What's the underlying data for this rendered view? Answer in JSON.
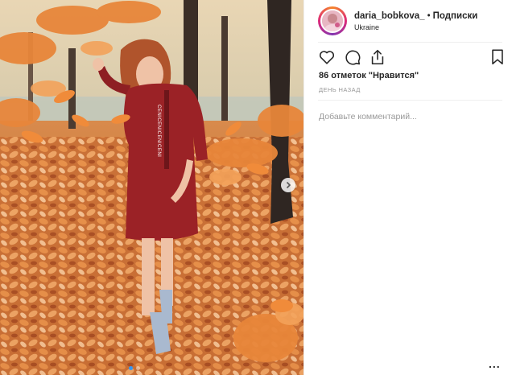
{
  "post": {
    "username": "daria_bobkova_",
    "separator": "•",
    "follow_label": "Подписки",
    "location": "Ukraine",
    "likes_text": "86 отметок \"Нравится\"",
    "time_text": "ДЕНЬ НАЗАД",
    "comment_placeholder": "Добавьте комментарий...",
    "more_label": "..."
  },
  "photo": {
    "dress_print": "CENICENICENICENI",
    "carousel_count": 2,
    "carousel_active_index": 0
  },
  "icons": {
    "like": "heart-icon",
    "comment": "comment-bubble-icon",
    "share": "share-icon",
    "save": "bookmark-icon",
    "next": "chevron-right-icon"
  },
  "colors": {
    "text": "#262626",
    "muted": "#999999",
    "divider": "#efefef",
    "carousel_active": "#3897f0",
    "leaves": "#e07a2c",
    "dress": "#9b2226"
  }
}
